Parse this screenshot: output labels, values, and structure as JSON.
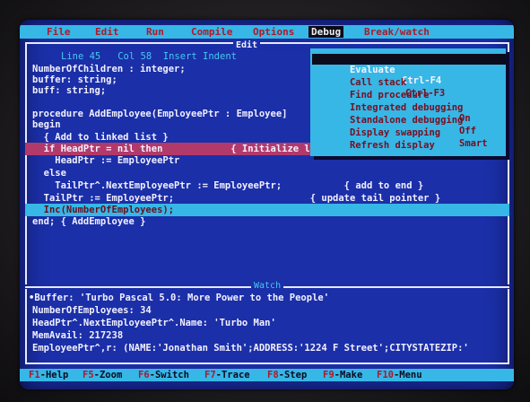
{
  "menu": {
    "items": [
      "File",
      "Edit",
      "Run",
      "Compile",
      "Options",
      "Debug",
      "Break/watch"
    ],
    "active_index": 5
  },
  "editor": {
    "title": "Edit",
    "status": "Line 45   Col 58  Insert Indent",
    "lines": [
      "NumberOfChildren : integer;",
      "buffer: string;",
      "buff: string;",
      "",
      "procedure AddEmployee(EmployeePtr : Employee]",
      "begin",
      "  { Add to linked list }",
      "  if HeadPtr = nil then            { Initialize list pointer }",
      "    HeadPtr := EmployeePtr",
      "  else",
      "    TailPtr^.NextEmployeePtr := EmployeePtr;           { add to end }",
      "  TailPtr := EmployeePtr;                        { update tail pointer }",
      "  Inc(NumberOfEmployees);",
      "end; { AddEmployee }"
    ],
    "highlight_line": 7,
    "selected_line": 12
  },
  "debug_menu": {
    "items": [
      {
        "label": "Evaluate",
        "shortcut": "Ctrl-F4",
        "value": ""
      },
      {
        "label": "Call stack",
        "shortcut": "Ctrl-F3",
        "value": ""
      },
      {
        "label": "Find procedure",
        "shortcut": "",
        "value": ""
      },
      {
        "label": "Integrated debugging",
        "shortcut": "",
        "value": "On"
      },
      {
        "label": "Standalone debugging",
        "shortcut": "",
        "value": "Off"
      },
      {
        "label": "Display swapping",
        "shortcut": "",
        "value": "Smart"
      },
      {
        "label": "Refresh display",
        "shortcut": "",
        "value": ""
      }
    ],
    "selected_index": 0
  },
  "watch": {
    "title": "Watch",
    "lines": [
      "•Buffer: 'Turbo Pascal 5.0: More Power to the People'",
      "NumberOfEmployees: 34",
      "HeadPtr^.NextEmployeePtr^.Name: 'Turbo Man'",
      "MemAvail: 217238",
      "EmployeePtr^,r: (NAME:'Jonathan Smith';ADDRESS:'1224 F Street';CITYSTATEZIP:'"
    ]
  },
  "statusbar": [
    {
      "key": "F1",
      "label": "-Help"
    },
    {
      "key": "F5",
      "label": "-Zoom"
    },
    {
      "key": "F6",
      "label": "-Switch"
    },
    {
      "key": "F7",
      "label": "-Trace"
    },
    {
      "key": "F8",
      "label": "-Step"
    },
    {
      "key": "F9",
      "label": "-Make"
    },
    {
      "key": "F10",
      "label": "-Menu"
    }
  ],
  "colors": {
    "screen_bg": "#1b2fa8",
    "menu_bg": "#37b7e6",
    "menu_text": "#b0172a",
    "highlight_row": "#b23a6a",
    "selection_row": "#37b7e6",
    "text": "#f2f0ff"
  }
}
